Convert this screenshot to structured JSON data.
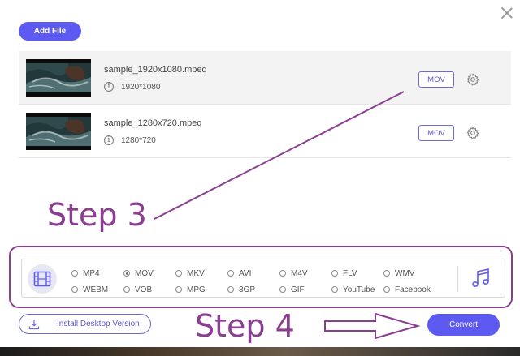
{
  "toolbar": {
    "add_file_label": "Add File"
  },
  "files": [
    {
      "name": "sample_1920x1080.mpeq",
      "resolution": "1920*1080",
      "format": "MOV"
    },
    {
      "name": "sample_1280x720.mpeq",
      "resolution": "1280*720",
      "format": "MOV"
    }
  ],
  "formats": {
    "row1": [
      "MP4",
      "MOV",
      "MKV",
      "AVI",
      "M4V",
      "FLV",
      "WMV"
    ],
    "row2": [
      "WEBM",
      "VOB",
      "MPG",
      "3GP",
      "GIF",
      "YouTube",
      "Facebook"
    ],
    "selected": "MOV"
  },
  "annotations": {
    "step3": "Step 3",
    "step4": "Step 4",
    "color": "#8b3d92"
  },
  "footer": {
    "install_label": "Install Desktop Version",
    "convert_label": "Convert"
  },
  "colors": {
    "accent": "#5d5af2",
    "annotation": "#8b3d92"
  },
  "icons": [
    "close-icon",
    "info-icon",
    "gear-icon",
    "video-icon",
    "music-icon",
    "download-icon"
  ]
}
